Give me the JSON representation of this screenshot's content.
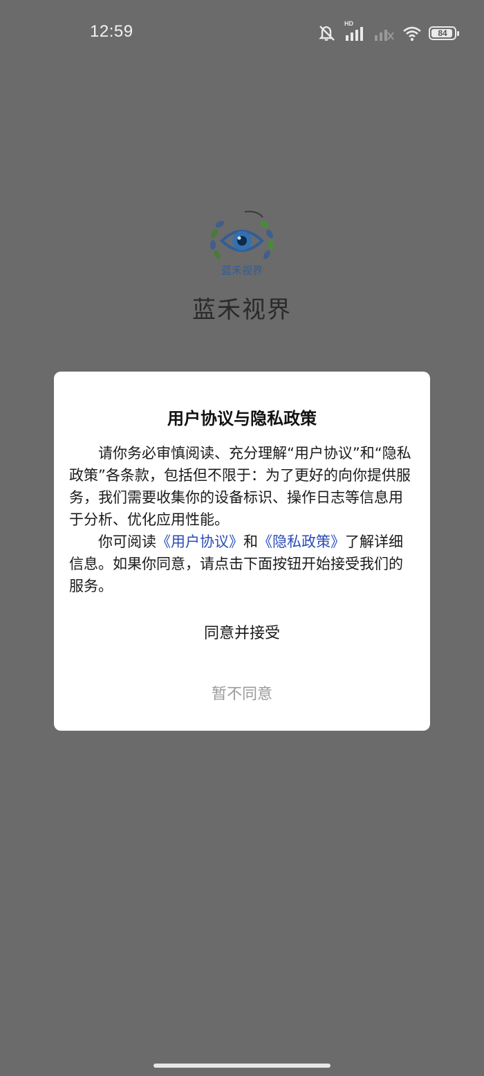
{
  "status_bar": {
    "time": "12:59",
    "battery_level": "84",
    "network_label": "HD",
    "icons": [
      "mute-icon",
      "signal-icon",
      "signal-weak-icon",
      "wifi-icon",
      "battery-icon"
    ]
  },
  "app": {
    "logo_text": "蓝禾视界",
    "name": "蓝禾视界"
  },
  "dialog": {
    "title": "用户协议与隐私政策",
    "para1": "请你务必审慎阅读、充分理解“用户协议”和“隐私政策”各条款，包括但不限于：为了更好的向你提供服务，我们需要收集你的设备标识、操作日志等信息用于分析、优化应用性能。",
    "para2_prefix": "你可阅读",
    "link_user_agreement": "《用户协议》",
    "para2_and": "和",
    "link_privacy_policy": "《隐私政策》",
    "para2_suffix": "了解详细信息。如果你同意，请点击下面按钮开始接受我们的服务。",
    "agree_button": "同意并接受",
    "disagree_button": "暂不同意"
  },
  "colors": {
    "overlay_bg": "#6b6b6b",
    "dialog_bg": "#ffffff",
    "link": "#2b4bb8",
    "disabled_text": "#9a9a9a"
  }
}
